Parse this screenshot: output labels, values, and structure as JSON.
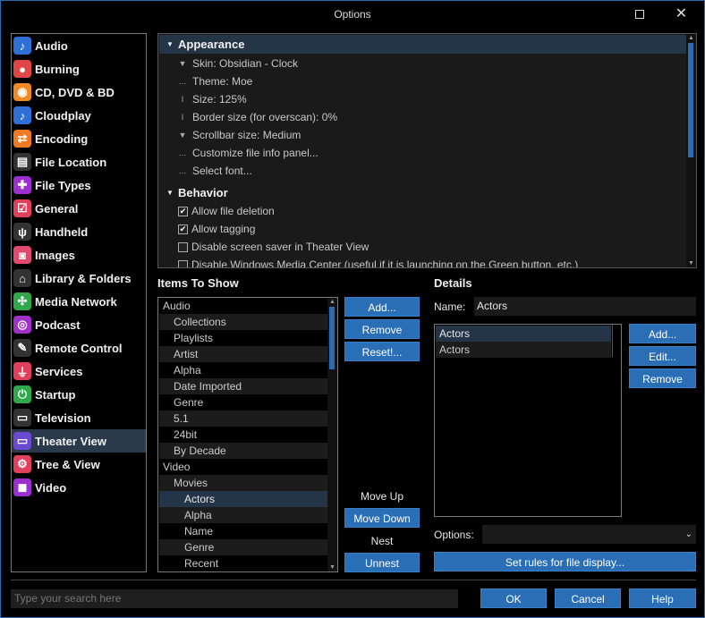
{
  "window": {
    "title": "Options"
  },
  "sidebar": {
    "items": [
      {
        "label": "Audio",
        "icon": "music-note-icon",
        "glyph": "♪",
        "color": "#2f6fd6"
      },
      {
        "label": "Burning",
        "icon": "disc-burn-icon",
        "glyph": "●",
        "color": "#e04646"
      },
      {
        "label": "CD, DVD & BD",
        "icon": "disc-icon",
        "glyph": "◉",
        "color": "#f08a24"
      },
      {
        "label": "Cloudplay",
        "icon": "music-note-icon",
        "glyph": "♪",
        "color": "#2f6fd6"
      },
      {
        "label": "Encoding",
        "icon": "convert-arrows-icon",
        "glyph": "⇄",
        "color": "#f07a24"
      },
      {
        "label": "File Location",
        "icon": "document-search-icon",
        "glyph": "▤",
        "color": "#333333"
      },
      {
        "label": "File Types",
        "icon": "puzzle-icon",
        "glyph": "✚",
        "color": "#9b2fd0"
      },
      {
        "label": "General",
        "icon": "checkbox-icon",
        "glyph": "☑",
        "color": "#e0405c"
      },
      {
        "label": "Handheld",
        "icon": "usb-icon",
        "glyph": "ψ",
        "color": "#333333"
      },
      {
        "label": "Images",
        "icon": "camera-icon",
        "glyph": "◙",
        "color": "#e04a6e"
      },
      {
        "label": "Library & Folders",
        "icon": "house-icon",
        "glyph": "⌂",
        "color": "#333333"
      },
      {
        "label": "Media Network",
        "icon": "network-icon",
        "glyph": "✣",
        "color": "#2ea84a"
      },
      {
        "label": "Podcast",
        "icon": "podcast-icon",
        "glyph": "◎",
        "color": "#a030c8"
      },
      {
        "label": "Remote Control",
        "icon": "remote-icon",
        "glyph": "✎",
        "color": "#333333"
      },
      {
        "label": "Services",
        "icon": "plug-icon",
        "glyph": "⏚",
        "color": "#e0405c"
      },
      {
        "label": "Startup",
        "icon": "power-icon",
        "glyph": "⏻",
        "color": "#2ea84a"
      },
      {
        "label": "Television",
        "icon": "tv-icon",
        "glyph": "▭",
        "color": "#333333"
      },
      {
        "label": "Theater View",
        "icon": "monitor-icon",
        "glyph": "▭",
        "color": "#6a4ad0"
      },
      {
        "label": "Tree & View",
        "icon": "gear-icon",
        "glyph": "⚙",
        "color": "#e0405c"
      },
      {
        "label": "Video",
        "icon": "film-camera-icon",
        "glyph": "◼",
        "color": "#9b2fd0"
      }
    ],
    "selected": "Theater View"
  },
  "tree": {
    "appearance": {
      "label": "Appearance",
      "rows": [
        {
          "glyph": "▼",
          "text": "Skin: Obsidian - Clock"
        },
        {
          "glyph": "…",
          "text": "Theme: Moe"
        },
        {
          "glyph": "I",
          "text": "Size: 125%"
        },
        {
          "glyph": "I",
          "text": "Border size (for overscan): 0%"
        },
        {
          "glyph": "▼",
          "text": "Scrollbar size: Medium"
        },
        {
          "glyph": "…",
          "text": "Customize file info panel..."
        },
        {
          "glyph": "…",
          "text": "Select font..."
        }
      ]
    },
    "behavior": {
      "label": "Behavior",
      "rows": [
        {
          "checked": true,
          "text": "Allow file deletion"
        },
        {
          "checked": true,
          "text": "Allow tagging"
        },
        {
          "checked": false,
          "text": "Disable screen saver in Theater View"
        },
        {
          "checked": false,
          "text": "Disable Windows Media Center (useful if it is launching on the Green button, etc.)"
        }
      ]
    }
  },
  "items_to_show": {
    "heading": "Items To Show",
    "rows": [
      {
        "text": "Audio",
        "indent": 0
      },
      {
        "text": "Collections",
        "indent": 1
      },
      {
        "text": "Playlists",
        "indent": 1
      },
      {
        "text": "Artist",
        "indent": 1
      },
      {
        "text": "Alpha",
        "indent": 1
      },
      {
        "text": "Date Imported",
        "indent": 1
      },
      {
        "text": "Genre",
        "indent": 1
      },
      {
        "text": "5.1",
        "indent": 1
      },
      {
        "text": "24bit",
        "indent": 1
      },
      {
        "text": "By Decade",
        "indent": 1
      },
      {
        "text": "Video",
        "indent": 0
      },
      {
        "text": "Movies",
        "indent": 1
      },
      {
        "text": "Actors",
        "indent": 2,
        "selected": true
      },
      {
        "text": "Alpha",
        "indent": 2
      },
      {
        "text": "Name",
        "indent": 2
      },
      {
        "text": "Genre",
        "indent": 2
      },
      {
        "text": "Recent",
        "indent": 2
      }
    ],
    "buttons": {
      "add": "Add...",
      "remove": "Remove",
      "reset": "Reset!...",
      "move_up": "Move Up",
      "move_down": "Move Down",
      "nest": "Nest",
      "unnest": "Unnest"
    }
  },
  "details": {
    "heading": "Details",
    "name_label": "Name:",
    "name_value": "Actors",
    "rows": [
      "Actors",
      "Actors"
    ],
    "buttons": {
      "add": "Add...",
      "edit": "Edit...",
      "remove": "Remove"
    },
    "options_label": "Options:",
    "options_value": "",
    "rules_button": "Set rules for file display..."
  },
  "footer": {
    "search_placeholder": "Type your search here",
    "ok": "OK",
    "cancel": "Cancel",
    "help": "Help"
  },
  "colors": {
    "accent": "#2a6fb5",
    "selection": "#243548"
  }
}
